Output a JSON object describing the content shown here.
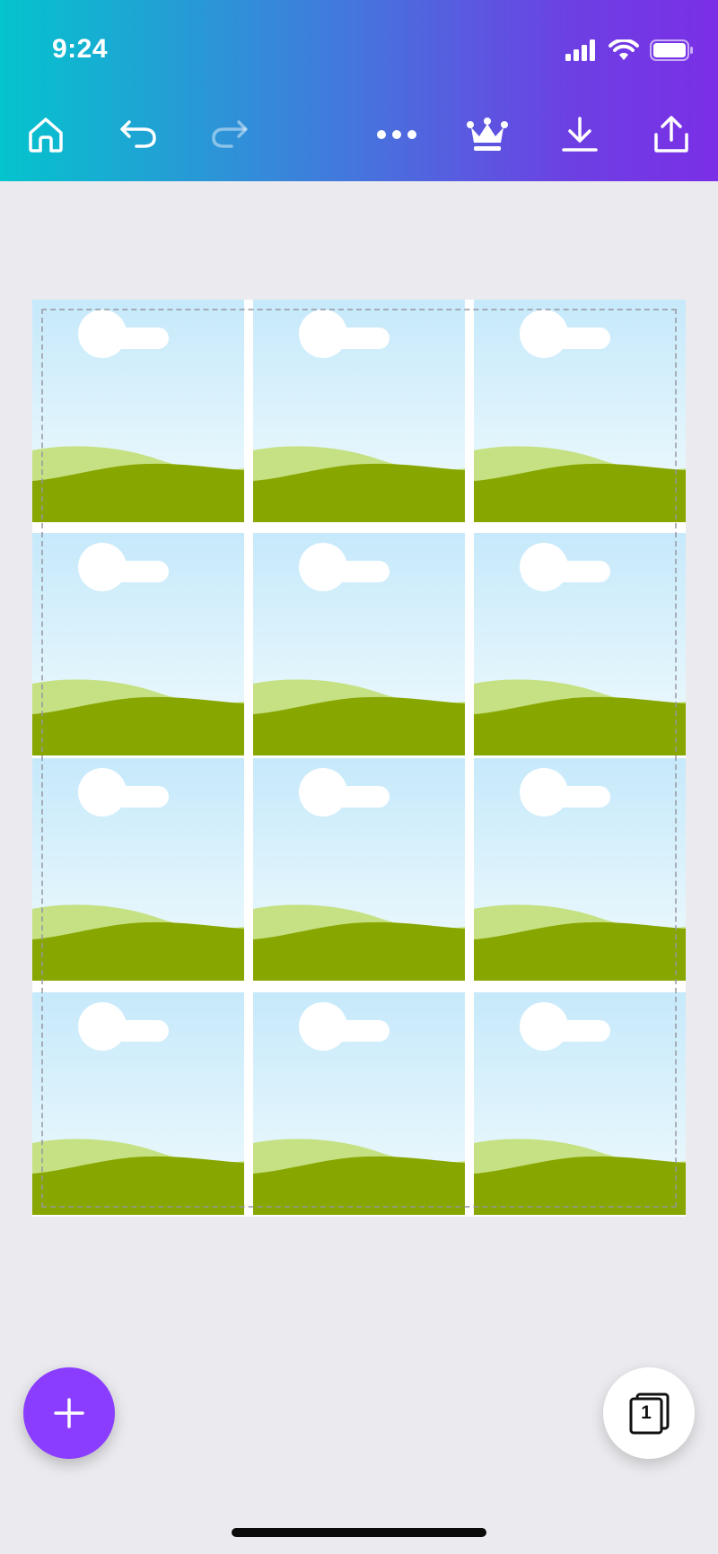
{
  "status_bar": {
    "time": "9:24"
  },
  "toolbar": {
    "items": [
      {
        "name": "home",
        "icon": "home-icon"
      },
      {
        "name": "undo",
        "icon": "undo-icon"
      },
      {
        "name": "redo",
        "icon": "redo-icon",
        "disabled": true
      },
      {
        "name": "more",
        "icon": "more-icon"
      },
      {
        "name": "premium",
        "icon": "crown-icon"
      },
      {
        "name": "download",
        "icon": "download-icon"
      },
      {
        "name": "share",
        "icon": "share-icon"
      }
    ]
  },
  "canvas": {
    "grid": {
      "rows": 4,
      "columns": 3
    },
    "tile_content": "placeholder-image-icon"
  },
  "fab": {
    "icon": "plus-icon"
  },
  "pages_button": {
    "icon": "pages-icon",
    "count": "1"
  },
  "colors": {
    "gradient_start": "#04c4cd",
    "gradient_end": "#7b2fe6",
    "fab": "#8b3dff",
    "background": "#ebebef"
  }
}
